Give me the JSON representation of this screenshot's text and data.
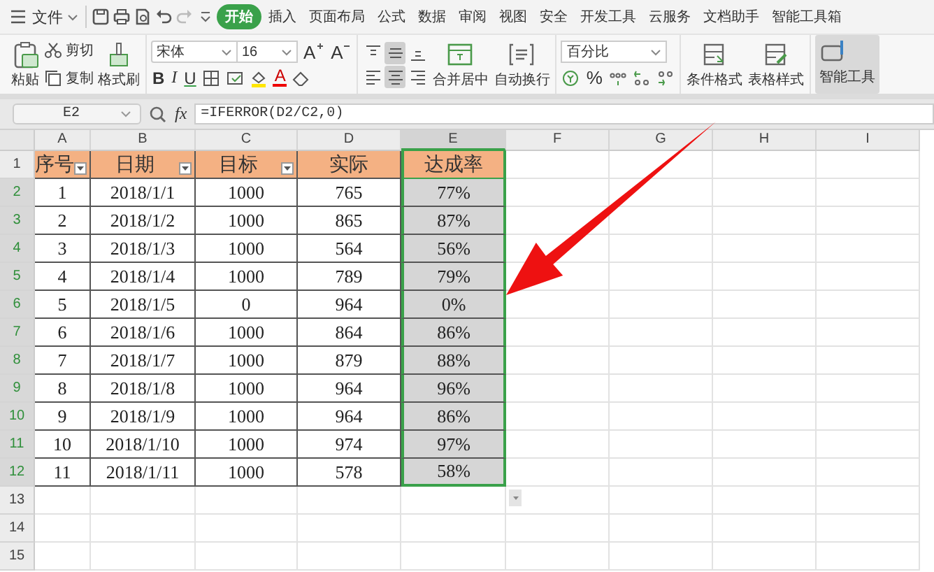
{
  "menu": {
    "file": "文件",
    "tabs": [
      {
        "label": "开始",
        "selected": true
      },
      {
        "label": "插入",
        "selected": false
      },
      {
        "label": "页面布局",
        "selected": false
      },
      {
        "label": "公式",
        "selected": false
      },
      {
        "label": "数据",
        "selected": false
      },
      {
        "label": "审阅",
        "selected": false
      },
      {
        "label": "视图",
        "selected": false
      },
      {
        "label": "安全",
        "selected": false
      },
      {
        "label": "开发工具",
        "selected": false
      },
      {
        "label": "云服务",
        "selected": false
      },
      {
        "label": "文档助手",
        "selected": false
      },
      {
        "label": "智能工具箱",
        "selected": false
      }
    ]
  },
  "ribbon": {
    "paste": "粘贴",
    "cut": "剪切",
    "copy": "复制",
    "format_painter": "格式刷",
    "font": {
      "name": "宋体",
      "size": "16",
      "grow": "A",
      "shrink": "A",
      "styles": [
        "B",
        "I",
        "U"
      ],
      "color_button": "A"
    },
    "align": [
      {
        "kind": "top",
        "selected": false
      },
      {
        "kind": "middle",
        "selected": true
      },
      {
        "kind": "bottom",
        "selected": false
      },
      {
        "kind": "left",
        "selected": false
      },
      {
        "kind": "center",
        "selected": true
      },
      {
        "kind": "right",
        "selected": false
      }
    ],
    "merge": "合并居中",
    "wrap": "自动换行",
    "number_format": "百分比",
    "percent": "%",
    "conditional": "条件格式",
    "table_style": "表格样式",
    "toolbox": "智能工具"
  },
  "formula_bar": {
    "cell": "E2",
    "fx": "fx",
    "formula": "=IFERROR(D2/C2,0)"
  },
  "sheet": {
    "columns": [
      {
        "label": "A",
        "selected": false
      },
      {
        "label": "B",
        "selected": false
      },
      {
        "label": "C",
        "selected": false
      },
      {
        "label": "D",
        "selected": false
      },
      {
        "label": "E",
        "selected": true
      },
      {
        "label": "F",
        "selected": false
      },
      {
        "label": "G",
        "selected": false
      },
      {
        "label": "H",
        "selected": false
      },
      {
        "label": "I",
        "selected": false
      }
    ],
    "header": [
      {
        "text": "序号",
        "filter": true
      },
      {
        "text": "日期",
        "filter": true
      },
      {
        "text": "目标",
        "filter": true
      },
      {
        "text": "实际",
        "filter": false
      },
      {
        "text": "达成率",
        "filter": false
      }
    ],
    "rows": [
      {
        "number": "1",
        "selected": false
      },
      {
        "number": "2",
        "selected": true,
        "cells": [
          "1",
          "2018/1/1",
          "1000",
          "765",
          "77%"
        ]
      },
      {
        "number": "3",
        "selected": true,
        "cells": [
          "2",
          "2018/1/2",
          "1000",
          "865",
          "87%"
        ]
      },
      {
        "number": "4",
        "selected": true,
        "cells": [
          "3",
          "2018/1/3",
          "1000",
          "564",
          "56%"
        ]
      },
      {
        "number": "5",
        "selected": true,
        "cells": [
          "4",
          "2018/1/4",
          "1000",
          "789",
          "79%"
        ]
      },
      {
        "number": "6",
        "selected": true,
        "cells": [
          "5",
          "2018/1/5",
          "0",
          "964",
          "0%"
        ]
      },
      {
        "number": "7",
        "selected": true,
        "cells": [
          "6",
          "2018/1/6",
          "1000",
          "864",
          "86%"
        ]
      },
      {
        "number": "8",
        "selected": true,
        "cells": [
          "7",
          "2018/1/7",
          "1000",
          "879",
          "88%"
        ]
      },
      {
        "number": "9",
        "selected": true,
        "cells": [
          "8",
          "2018/1/8",
          "1000",
          "964",
          "96%"
        ]
      },
      {
        "number": "10",
        "selected": true,
        "cells": [
          "9",
          "2018/1/9",
          "1000",
          "964",
          "86%"
        ]
      },
      {
        "number": "11",
        "selected": true,
        "cells": [
          "10",
          "2018/1/10",
          "1000",
          "974",
          "97%"
        ]
      },
      {
        "number": "12",
        "selected": true,
        "cells": [
          "11",
          "2018/1/11",
          "1000",
          "578",
          "58%"
        ]
      },
      {
        "number": "13",
        "selected": false
      },
      {
        "number": "14",
        "selected": false
      },
      {
        "number": "15",
        "selected": false
      }
    ]
  }
}
